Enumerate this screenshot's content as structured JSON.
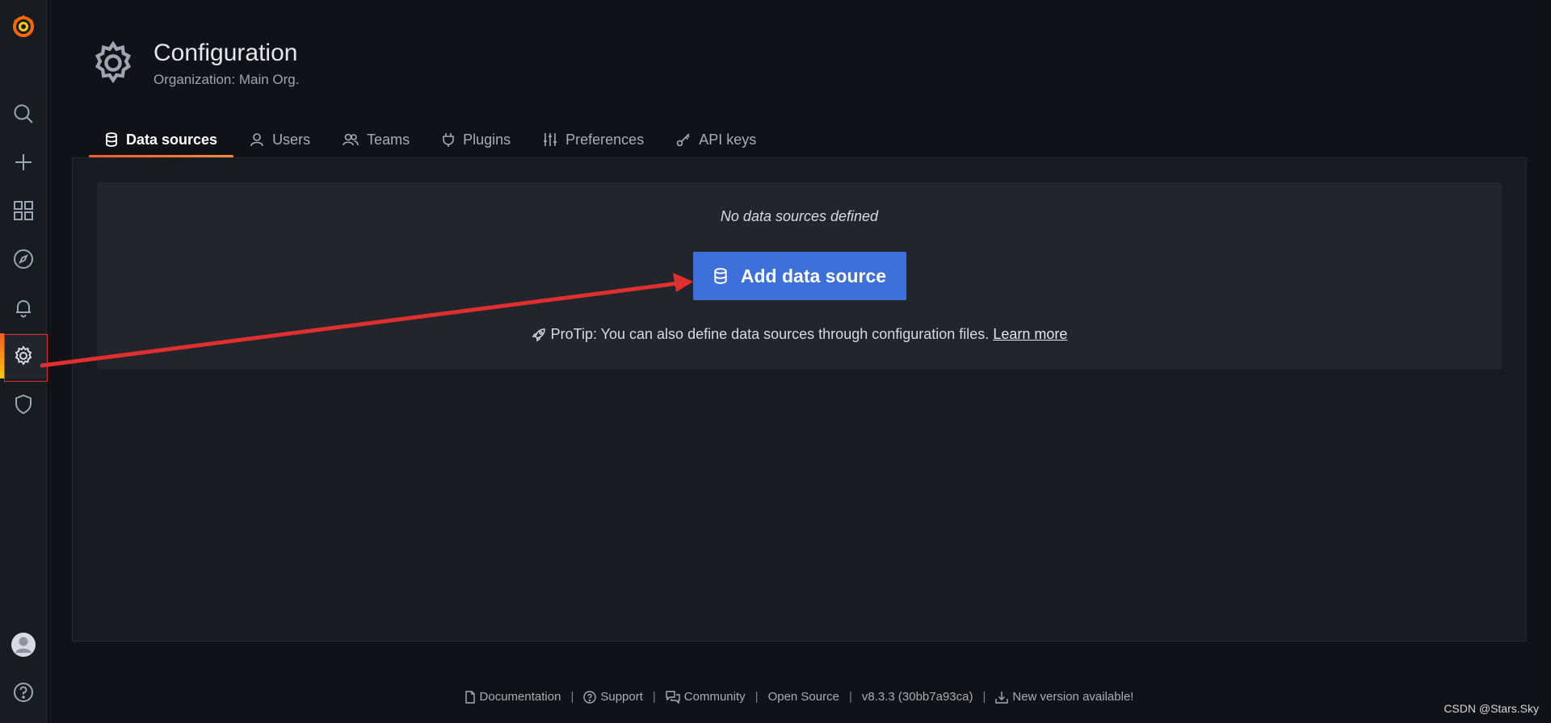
{
  "sidebar": {
    "items": [
      {
        "icon": "grafana-logo"
      },
      {
        "icon": "search-icon"
      },
      {
        "icon": "plus-icon"
      },
      {
        "icon": "dashboards-icon"
      },
      {
        "icon": "compass-icon"
      },
      {
        "icon": "bell-icon"
      },
      {
        "icon": "gear-icon",
        "active": true
      },
      {
        "icon": "shield-icon"
      },
      {
        "icon": "avatar"
      },
      {
        "icon": "help-icon"
      }
    ]
  },
  "header": {
    "title": "Configuration",
    "subtitle": "Organization: Main Org."
  },
  "tabs": [
    {
      "label": "Data sources",
      "icon": "database-icon",
      "active": true
    },
    {
      "label": "Users",
      "icon": "user-icon"
    },
    {
      "label": "Teams",
      "icon": "users-icon"
    },
    {
      "label": "Plugins",
      "icon": "plug-icon"
    },
    {
      "label": "Preferences",
      "icon": "sliders-icon"
    },
    {
      "label": "API keys",
      "icon": "key-icon"
    }
  ],
  "empty_state": {
    "message": "No data sources defined",
    "button_label": "Add data source",
    "protip": "ProTip: You can also define data sources through configuration files.",
    "learn_more": "Learn more"
  },
  "footer": {
    "documentation": "Documentation",
    "support": "Support",
    "community": "Community",
    "open_source": "Open Source",
    "version": "v8.3.3 (30bb7a93ca)",
    "new_version": "New version available!",
    "separator": "|"
  },
  "watermark": "CSDN @Stars.Sky",
  "colors": {
    "accent": "#f05a28",
    "primary_button": "#3d71d9",
    "annotation_red": "#e02f2f"
  }
}
